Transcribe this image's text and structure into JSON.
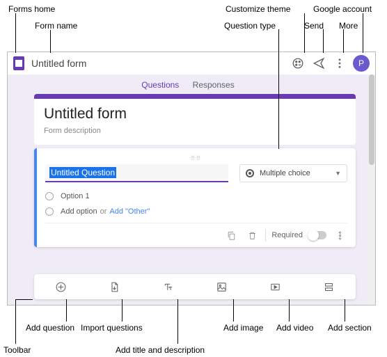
{
  "annotations": {
    "forms_home": "Forms home",
    "form_name": "Form name",
    "customize_theme": "Customize theme",
    "question_type": "Question type",
    "send": "Send",
    "google_account": "Google account",
    "more": "More",
    "toolbar": "Toolbar",
    "add_question": "Add question",
    "import_questions": "Import questions",
    "add_title_desc": "Add title and description",
    "add_image": "Add image",
    "add_video": "Add video",
    "add_section": "Add section"
  },
  "header": {
    "doc_name": "Untitled form",
    "avatar_letter": "P"
  },
  "tabs": {
    "questions": "Questions",
    "responses": "Responses"
  },
  "title_card": {
    "title": "Untitled form",
    "description": "Form description"
  },
  "question": {
    "text": "Untitled Question",
    "type_label": "Multiple choice",
    "option1": "Option 1",
    "add_option": "Add option",
    "or": "or",
    "add_other": "Add \"Other\"",
    "required": "Required"
  }
}
